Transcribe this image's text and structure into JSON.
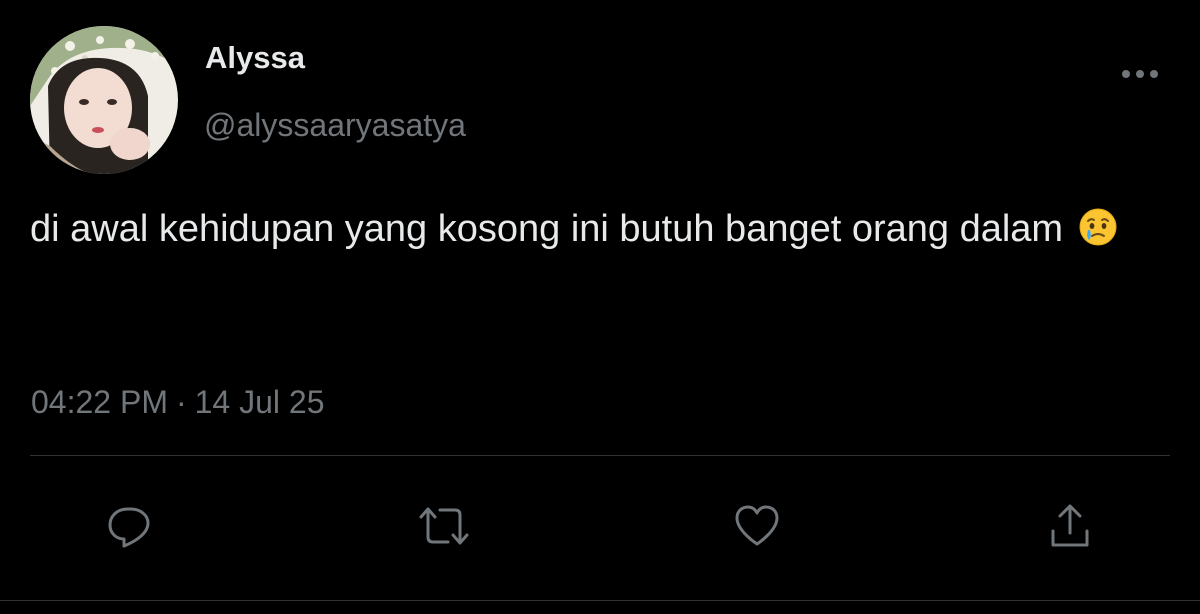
{
  "author": {
    "display_name": "Alyssa",
    "handle": "@alyssaaryasatya"
  },
  "tweet": {
    "text": "di awal kehidupan yang kosong ini butuh banget orang dalam",
    "emoji": "face-holding-back-tears-icon"
  },
  "meta": {
    "time": "04:22 PM",
    "separator": "·",
    "date": "14 Jul 25"
  },
  "actions": {
    "reply": "reply-icon",
    "retweet": "retweet-icon",
    "like": "heart-icon",
    "share": "share-icon"
  },
  "colors": {
    "background": "#000000",
    "primary_text": "#e7e9ea",
    "secondary_text": "#71767b",
    "divider": "#2f3336"
  }
}
